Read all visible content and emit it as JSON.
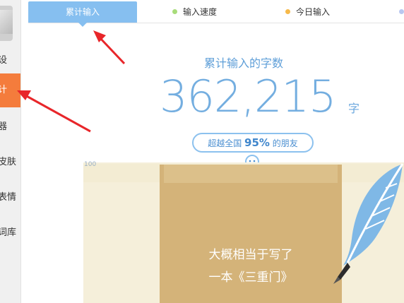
{
  "sidebar": {
    "items": [
      {
        "label": "设"
      },
      {
        "label": "计"
      },
      {
        "label": "器"
      },
      {
        "label": "皮肤"
      },
      {
        "label": "表情"
      },
      {
        "label": "词库"
      }
    ]
  },
  "tabs": [
    {
      "label": "累计输入",
      "active": true
    },
    {
      "label": "输入速度",
      "dot_color": "#a8dc7a"
    },
    {
      "label": "今日输入",
      "dot_color": "#f6b94a"
    },
    {
      "label": "",
      "dot_color": "#b9c7f0"
    }
  ],
  "main": {
    "subtitle": "累计输入的字数",
    "count": "362,215",
    "unit": "字",
    "beat_prefix": "超越全国",
    "beat_percent": "95%",
    "beat_suffix": "的朋友",
    "axis_tick": "100",
    "caption_line1": "大概相当于写了",
    "caption_line2": "一本《三重门》"
  },
  "colors": {
    "accent_blue": "#86bff0",
    "sidebar_active": "#f47c3c",
    "bar": "#d4b379",
    "stage": "#f5efda",
    "arrow": "#e8262a"
  }
}
